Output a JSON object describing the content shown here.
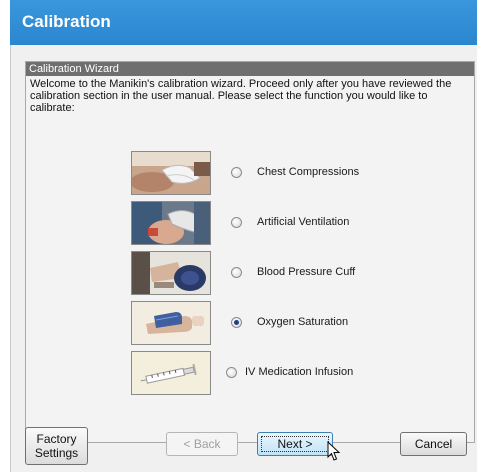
{
  "window": {
    "title": "Calibration"
  },
  "wizard": {
    "header": "Calibration Wizard",
    "intro": "Welcome to the Manikin's calibration wizard.  Proceed only after you have reviewed the calibration section in the user manual.  Please select the function you would like to calibrate:"
  },
  "options": [
    {
      "label": "Chest Compressions",
      "selected": false,
      "icon": "hands-on-chest-image"
    },
    {
      "label": "Artificial Ventilation",
      "selected": false,
      "icon": "ventilation-image"
    },
    {
      "label": "Blood Pressure Cuff",
      "selected": false,
      "icon": "bp-cuff-image"
    },
    {
      "label": "Oxygen Saturation",
      "selected": true,
      "icon": "pulse-oximeter-image"
    },
    {
      "label": "IV Medication Infusion",
      "selected": false,
      "icon": "syringe-image"
    }
  ],
  "buttons": {
    "factory_line1": "Factory",
    "factory_line2": "Settings",
    "back": "< Back",
    "next": "Next >",
    "cancel": "Cancel"
  },
  "colors": {
    "titlebar": "#2f8fd6",
    "panel": "#f0f0f0",
    "wizard_header": "#6f6f6f"
  }
}
